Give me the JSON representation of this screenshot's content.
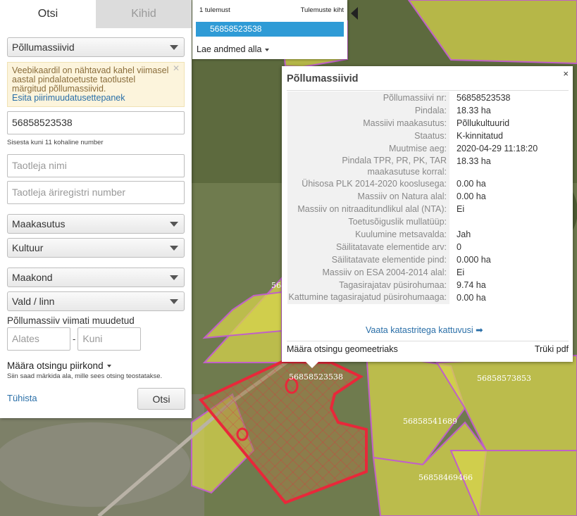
{
  "tabs": {
    "search": "Otsi",
    "layers": "Kihid"
  },
  "search": {
    "type_select": "Põllumassiivid",
    "notice_text": "Veebikaardil on nähtavad kahel viimasel aastal pindalatoetuste taotlustel märgitud põllumassiivid.",
    "notice_link": "Esita piirimuudatusettepanek",
    "number_value": "56858523538",
    "number_hint": "Sisesta kuni 11 kohaline number",
    "applicant_placeholder": "Taotleja nimi",
    "regcode_placeholder": "Taotleja äriregistri number",
    "land_use_select": "Maakasutus",
    "crop_select": "Kultuur",
    "county_select": "Maakond",
    "parish_select": "Vald / linn",
    "changed_label": "Põllumassiiv viimati muudetud",
    "from_placeholder": "Alates",
    "date_separator": "-",
    "to_placeholder": "Kuni",
    "area_label": "Määra otsingu piirkond",
    "area_hint": "Siin saad märkida ala, mille sees otsing teostatakse.",
    "cancel_label": "Tühista",
    "search_button": "Otsi"
  },
  "results": {
    "count_label": "1 tulemust",
    "view_label": "Tulemuste kiht",
    "items": [
      "56858523538"
    ],
    "download_label": "Lae andmed alla"
  },
  "popup": {
    "title": "Põllumassiivid",
    "close_symbol": "×",
    "rows": [
      {
        "k": "Põllumassiivi nr:",
        "v": "56858523538"
      },
      {
        "k": "Pindala:",
        "v": "18.33 ha"
      },
      {
        "k": "Massiivi maakasutus:",
        "v": "Põllukultuurid"
      },
      {
        "k": "Staatus:",
        "v": "K-kinnitatud"
      },
      {
        "k": "Muutmise aeg:",
        "v": "2020-04-29 11:18:20"
      },
      {
        "k": "Pindala TPR, PR, PK, TAR maakasutuse korral:",
        "v": "18.33 ha"
      },
      {
        "k": "Ühisosa PLK 2014-2020 kooslusega:",
        "v": "0.00 ha"
      },
      {
        "k": "Massiiv on Natura alal:",
        "v": "0.00 ha"
      },
      {
        "k": "Massiiv on nitraaditundlikul alal (NTA):",
        "v": "Ei"
      },
      {
        "k": "Toetusõiguslik mullatüüp:",
        "v": ""
      },
      {
        "k": "Kuulumine metsavalda:",
        "v": "Jah"
      },
      {
        "k": "Säilitatavate elementide arv:",
        "v": "0"
      },
      {
        "k": "Säilitatavate elementide pind:",
        "v": "0.000 ha"
      },
      {
        "k": "Massiiv on ESA 2004-2014 alal:",
        "v": "Ei"
      },
      {
        "k": "Tagasirajatav püsirohumaa:",
        "v": "9.74 ha"
      },
      {
        "k": "Kattumine tagasirajatud püsirohumaaga:",
        "v": "0.00 ha"
      }
    ],
    "cadastre_link": "Vaata katastritega kattuvusi",
    "define_geometry": "Määra otsingu geomeetriaks",
    "print_pdf": "Trüki pdf"
  },
  "map": {
    "labels": [
      "56858523538",
      "56858573853",
      "56858541689",
      "56858469466",
      "56858"
    ],
    "colors": {
      "parcel_fill": "#d8d64c",
      "parcel_border": "#c060c8",
      "selected": "#e8283a",
      "link": "#2a6fa8",
      "result_highlight": "#2f9bd6"
    }
  }
}
